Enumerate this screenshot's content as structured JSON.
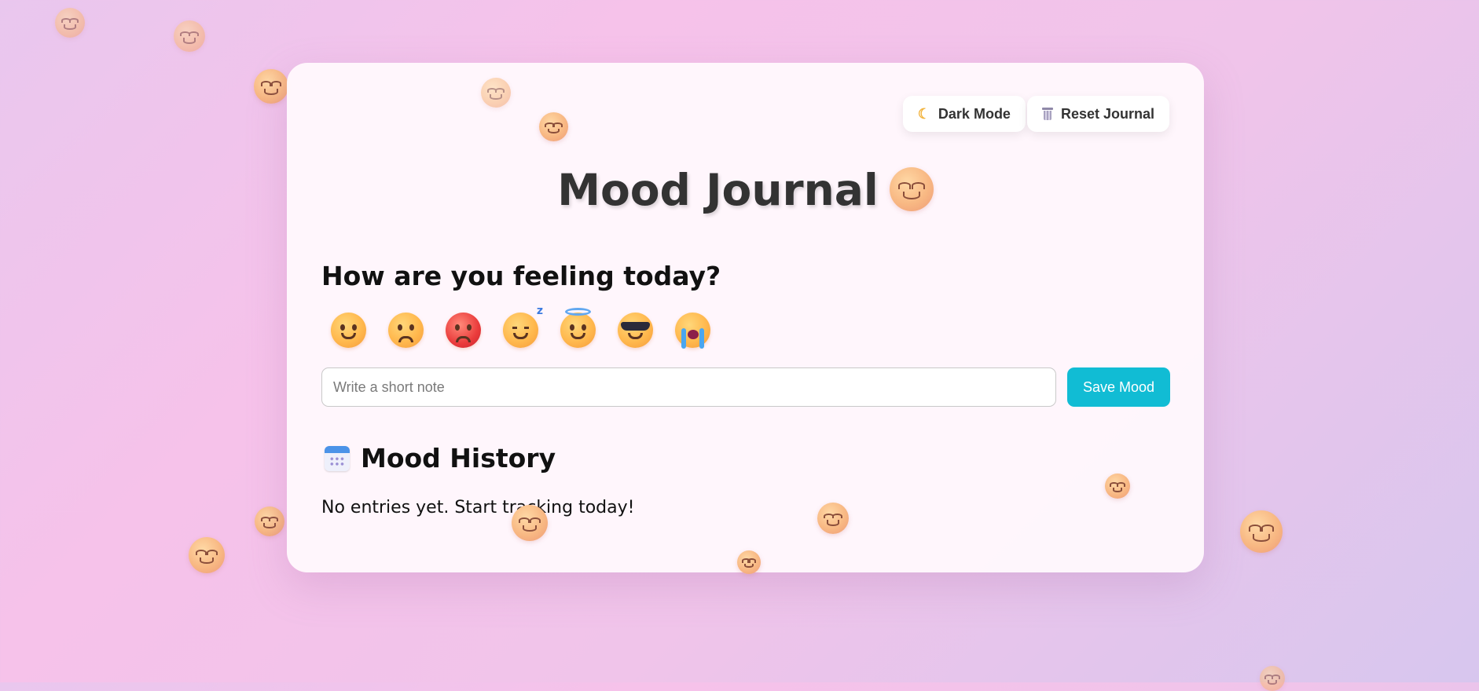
{
  "header": {
    "dark_mode_label": "Dark Mode",
    "reset_label": "Reset Journal",
    "dark_mode_icon": "moon-icon",
    "reset_icon": "wastebasket-icon"
  },
  "title": {
    "text": "Mood Journal",
    "icon": "smiling-face-icon"
  },
  "prompt": {
    "question": "How are you feeling today?"
  },
  "moods": [
    {
      "name": "happy",
      "icon": "smiling-face-icon"
    },
    {
      "name": "worried",
      "icon": "pleading-face-icon"
    },
    {
      "name": "angry",
      "icon": "angry-face-icon"
    },
    {
      "name": "sleepy",
      "icon": "sleeping-face-icon"
    },
    {
      "name": "blessed",
      "icon": "halo-face-icon"
    },
    {
      "name": "cool",
      "icon": "sunglasses-face-icon"
    },
    {
      "name": "crying",
      "icon": "crying-face-icon"
    }
  ],
  "note": {
    "placeholder": "Write a short note",
    "value": ""
  },
  "save_button": {
    "label": "Save Mood",
    "color": "#11bcd4"
  },
  "history": {
    "title": "Mood History",
    "icon": "calendar-icon",
    "empty_message": "No entries yet. Start tracking today!"
  },
  "colors": {
    "card_background": "#fff8fc",
    "text_dark": "#333333",
    "accent": "#11bcd4"
  }
}
